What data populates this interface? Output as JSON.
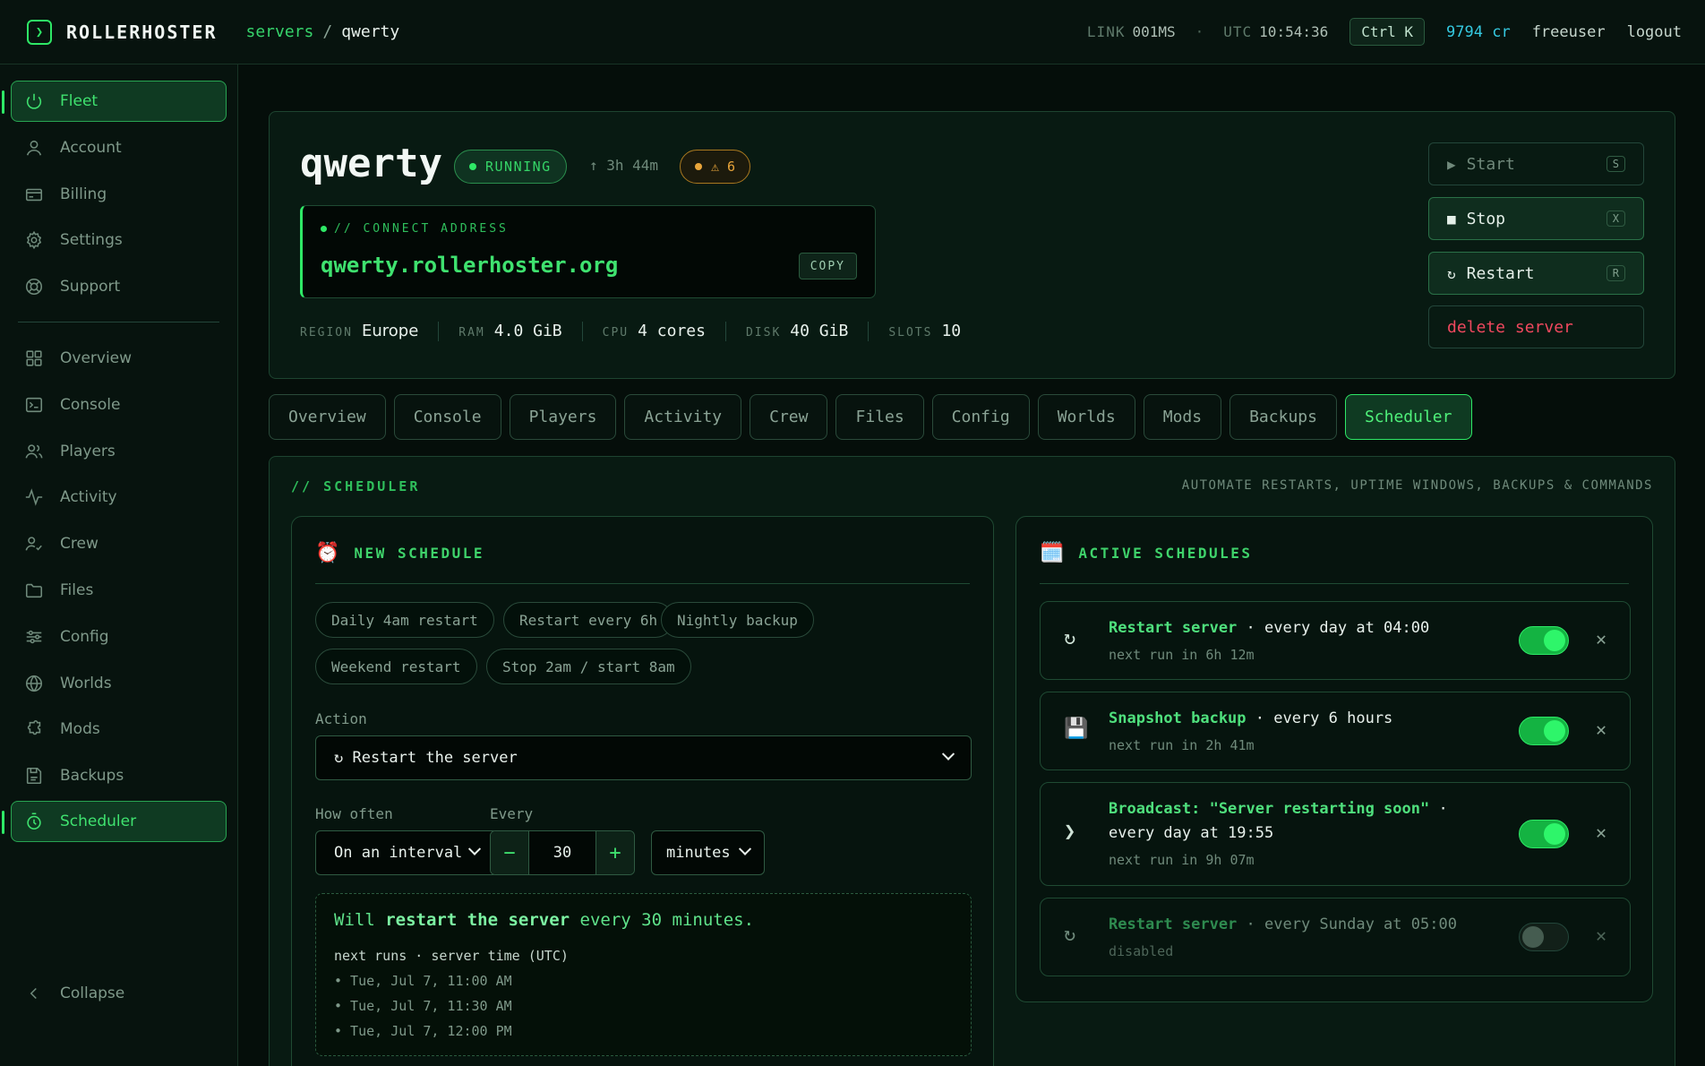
{
  "topbar": {
    "brand": "ROLLERHOSTER",
    "crumb_root": "servers",
    "crumb_sep": "/",
    "crumb_current": "qwerty",
    "link_label": "LINK",
    "link_value": "001MS",
    "dot": "·",
    "utc_label": "UTC",
    "utc_value": "10:54:36",
    "shortcut": "Ctrl K",
    "credits": "9794 cr",
    "username": "freeuser",
    "logout": "logout"
  },
  "sidebar": {
    "items": [
      {
        "label": "Fleet",
        "icon": "power-icon"
      },
      {
        "label": "Account",
        "icon": "user-icon"
      },
      {
        "label": "Billing",
        "icon": "card-icon"
      },
      {
        "label": "Settings",
        "icon": "gear-icon"
      },
      {
        "label": "Support",
        "icon": "lifebuoy-icon"
      },
      {
        "label": "Overview",
        "icon": "grid-icon"
      },
      {
        "label": "Console",
        "icon": "terminal-icon"
      },
      {
        "label": "Players",
        "icon": "users-icon"
      },
      {
        "label": "Activity",
        "icon": "pulse-icon"
      },
      {
        "label": "Crew",
        "icon": "user-check-icon"
      },
      {
        "label": "Files",
        "icon": "folder-icon"
      },
      {
        "label": "Config",
        "icon": "sliders-icon"
      },
      {
        "label": "Worlds",
        "icon": "globe-icon"
      },
      {
        "label": "Mods",
        "icon": "puzzle-icon"
      },
      {
        "label": "Backups",
        "icon": "save-icon"
      },
      {
        "label": "Scheduler",
        "icon": "timer-icon"
      }
    ],
    "collapse": "Collapse"
  },
  "server": {
    "name": "qwerty",
    "status": "RUNNING",
    "uptime": "↑ 3h 44m",
    "warnings": "⚠ 6",
    "connect_label": "// CONNECT ADDRESS",
    "connect_address": "qwerty.rollerhoster.org",
    "copy": "COPY",
    "specs": [
      {
        "key": "REGION",
        "value": "Europe"
      },
      {
        "key": "RAM",
        "value": "4.0 GiB"
      },
      {
        "key": "CPU",
        "value": "4 cores"
      },
      {
        "key": "DISK",
        "value": "40 GiB"
      },
      {
        "key": "SLOTS",
        "value": "10"
      }
    ],
    "actions": {
      "start": "Start",
      "start_key": "S",
      "start_icon": "▶",
      "stop": "Stop",
      "stop_key": "X",
      "stop_icon": "■",
      "restart": "Restart",
      "restart_key": "R",
      "restart_icon": "↻",
      "delete": "delete server"
    }
  },
  "tabs": [
    "Overview",
    "Console",
    "Players",
    "Activity",
    "Crew",
    "Files",
    "Config",
    "Worlds",
    "Mods",
    "Backups",
    "Scheduler"
  ],
  "scheduler": {
    "title": "// SCHEDULER",
    "subtitle": "AUTOMATE RESTARTS, UPTIME WINDOWS, BACKUPS & COMMANDS",
    "new": {
      "emoji": "⏰",
      "title": "NEW SCHEDULE",
      "presets": [
        "Daily 4am restart",
        "Restart every 6h",
        "Nightly backup",
        "Weekend restart",
        "Stop 2am / start 8am"
      ],
      "action_label": "Action",
      "action_value": "↻ Restart the server",
      "how_often_label": "How often",
      "how_often_value": "On an interval",
      "every_label": "Every",
      "every_value": "30",
      "minus": "−",
      "plus": "+",
      "unit_value": "minutes",
      "summary_pre": "Will ",
      "summary_bold": "restart the server",
      "summary_post": " every 30 minutes.",
      "next_label": "next runs · server time (UTC)",
      "runs": [
        "• Tue, Jul 7, 11:00 AM",
        "• Tue, Jul 7, 11:30 AM",
        "• Tue, Jul 7, 12:00 PM"
      ]
    },
    "active": {
      "emoji": "🗓️",
      "title": "ACTIVE SCHEDULES",
      "close": "✕",
      "items": [
        {
          "icon": "↻",
          "name": "Restart server",
          "rest": " · every day at 04:00",
          "next": "next run in 6h 12m",
          "enabled": true
        },
        {
          "icon": "💾",
          "name": "Snapshot backup",
          "rest": " · every 6 hours",
          "next": "next run in 2h 41m",
          "enabled": true
        },
        {
          "icon": "❯",
          "name": "Broadcast: \"Server restarting soon\"",
          "rest": " ·",
          "rest2": "every day at 19:55",
          "next": "next run in 9h 07m",
          "enabled": true
        },
        {
          "icon": "↻",
          "name": "Restart server",
          "rest": " · every Sunday at 05:00",
          "next": "disabled",
          "enabled": false
        }
      ]
    }
  }
}
